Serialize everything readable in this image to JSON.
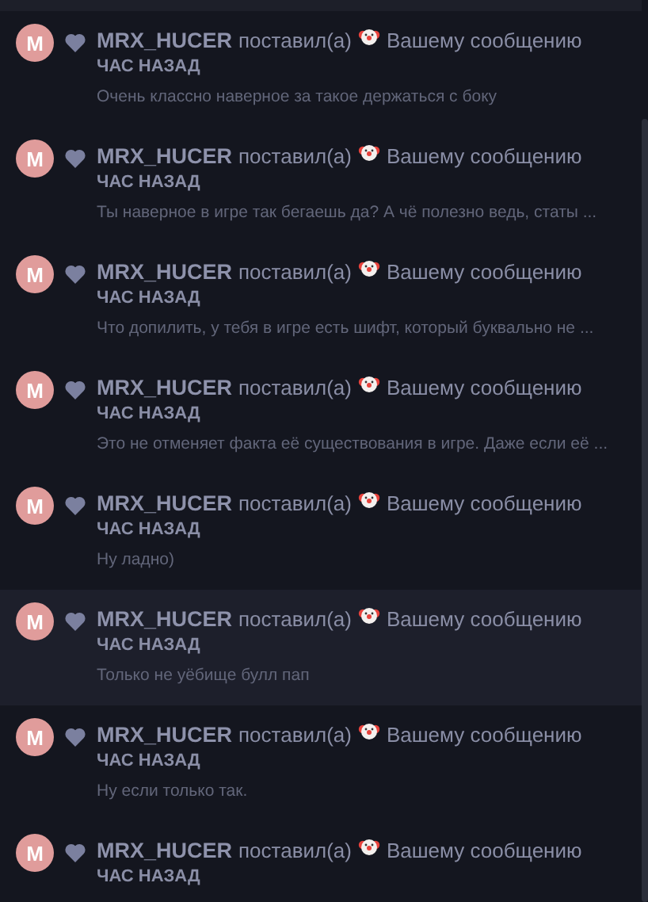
{
  "notifications": [
    {
      "avatar_letter": "M",
      "user": "MRX_HUCER",
      "action": "поставил(а)",
      "target": "Вашему сообщению",
      "time": "ЧАС НАЗАД",
      "message": "Очень классно наверное за такое держаться с боку",
      "highlighted": false
    },
    {
      "avatar_letter": "M",
      "user": "MRX_HUCER",
      "action": "поставил(а)",
      "target": "Вашему сообщению",
      "time": "ЧАС НАЗАД",
      "message": "Ты наверное в игре так бегаешь да? А чё полезно ведь, статы ...",
      "highlighted": false
    },
    {
      "avatar_letter": "M",
      "user": "MRX_HUCER",
      "action": "поставил(а)",
      "target": "Вашему сообщению",
      "time": "ЧАС НАЗАД",
      "message": "Что допилить, у тебя в игре есть шифт, который буквально не ...",
      "highlighted": false
    },
    {
      "avatar_letter": "M",
      "user": "MRX_HUCER",
      "action": "поставил(а)",
      "target": "Вашему сообщению",
      "time": "ЧАС НАЗАД",
      "message": "Это не отменяет факта её существования в игре. Даже если её ...",
      "highlighted": false
    },
    {
      "avatar_letter": "M",
      "user": "MRX_HUCER",
      "action": "поставил(а)",
      "target": "Вашему сообщению",
      "time": "ЧАС НАЗАД",
      "message": "Ну ладно)",
      "highlighted": false
    },
    {
      "avatar_letter": "M",
      "user": "MRX_HUCER",
      "action": "поставил(а)",
      "target": "Вашему сообщению",
      "time": "ЧАС НАЗАД",
      "message": "Только не уёбище булл пап",
      "highlighted": true
    },
    {
      "avatar_letter": "M",
      "user": "MRX_HUCER",
      "action": "поставил(а)",
      "target": "Вашему сообщению",
      "time": "ЧАС НАЗАД",
      "message": "Ну если только так.",
      "highlighted": false
    },
    {
      "avatar_letter": "M",
      "user": "MRX_HUCER",
      "action": "поставил(а)",
      "target": "Вашему сообщению",
      "time": "ЧАС НАЗАД",
      "highlighted": false
    }
  ]
}
